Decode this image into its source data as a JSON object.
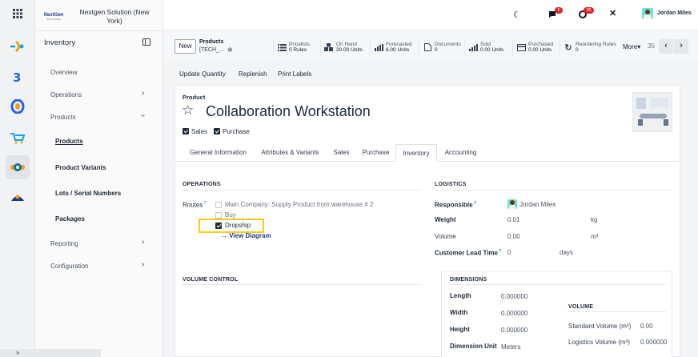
{
  "colors": {
    "accent": "#714b67",
    "highlight": "#facc15",
    "badge": "#dc2626",
    "link": "#1e3a8a"
  },
  "company": {
    "logo_text": "NextGen",
    "logo_sub": "SOLUTIONS",
    "name": "Nextgen Solution (New York)"
  },
  "rail_icons": [
    "apps-grid-icon",
    "discuss-app-icon",
    "accounting-app-icon",
    "project-app-icon",
    "sales-cart-icon",
    "inventory-app-icon",
    "delivery-app-icon"
  ],
  "sidebar": {
    "title": "Inventory",
    "items": {
      "overview": "Overview",
      "operations": "Operations",
      "products": "Products",
      "products_sub": "Products",
      "variants": "Product Variants",
      "lots": "Lots / Serial Numbers",
      "packages": "Packages",
      "reporting": "Reporting",
      "configuration": "Configuration"
    }
  },
  "topbar": {
    "messages_badge": "6",
    "activities_badge": "36",
    "user": "Jordan Miles"
  },
  "control": {
    "new_label": "New",
    "breadcrumb_parent": "Products",
    "breadcrumb_current": "[TECH_...",
    "stats": [
      {
        "label": "Pricelists",
        "value": "0 Rules"
      },
      {
        "label": "On Hand",
        "value": "20.00 Units"
      },
      {
        "label": "Forecasted",
        "value": "6.00 Units"
      },
      {
        "label": "Documents",
        "value": "0"
      },
      {
        "label": "Sold",
        "value": "0.00 Units"
      },
      {
        "label": "Purchased",
        "value": "0.00 Units"
      },
      {
        "label": "Reordering Rules",
        "value": "0"
      }
    ],
    "more": "More",
    "pager": "35"
  },
  "actions": {
    "update_qty": "Update Quantity",
    "replenish": "Replenish",
    "print_labels": "Print Labels"
  },
  "product": {
    "label": "Product",
    "name": "Collaboration Workstation",
    "sales": "Sales",
    "purchase": "Purchase"
  },
  "tabs": [
    "General Information",
    "Attributes & Variants",
    "Sales",
    "Purchase",
    "Inventory",
    "Accounting"
  ],
  "operations": {
    "header": "OPERATIONS",
    "routes_label": "Routes",
    "routes": [
      {
        "label": "Main Company: Supply Product from warehouse # 2",
        "checked": false
      },
      {
        "label": "Buy",
        "checked": false
      },
      {
        "label": "Dropship",
        "checked": true
      }
    ],
    "view_diagram": "View Diagram"
  },
  "logistics": {
    "header": "LOGISTICS",
    "responsible_label": "Responsible",
    "responsible": "Jordan Miles",
    "weight_label": "Weight",
    "weight": "0.01",
    "weight_unit": "kg",
    "volume_label": "Volume",
    "volume": "0.00",
    "volume_unit": "m³",
    "lead_label": "Customer Lead Time",
    "lead": "0",
    "lead_unit": "days"
  },
  "volume_control": {
    "header": "VOLUME CONTROL"
  },
  "dimensions": {
    "header": "DIMENSIONS",
    "length_label": "Length",
    "length": "0.000000",
    "width_label": "Width",
    "width": "0.000000",
    "height_label": "Height",
    "height": "0.000000",
    "unit_label": "Dimension Unit",
    "unit": "Meters"
  },
  "volume": {
    "header": "VOLUME",
    "standard_label": "Standard Volume (m³)",
    "standard": "0.00",
    "logistics_label": "Logistics Volume (m³)",
    "logistics": "0.000000"
  }
}
